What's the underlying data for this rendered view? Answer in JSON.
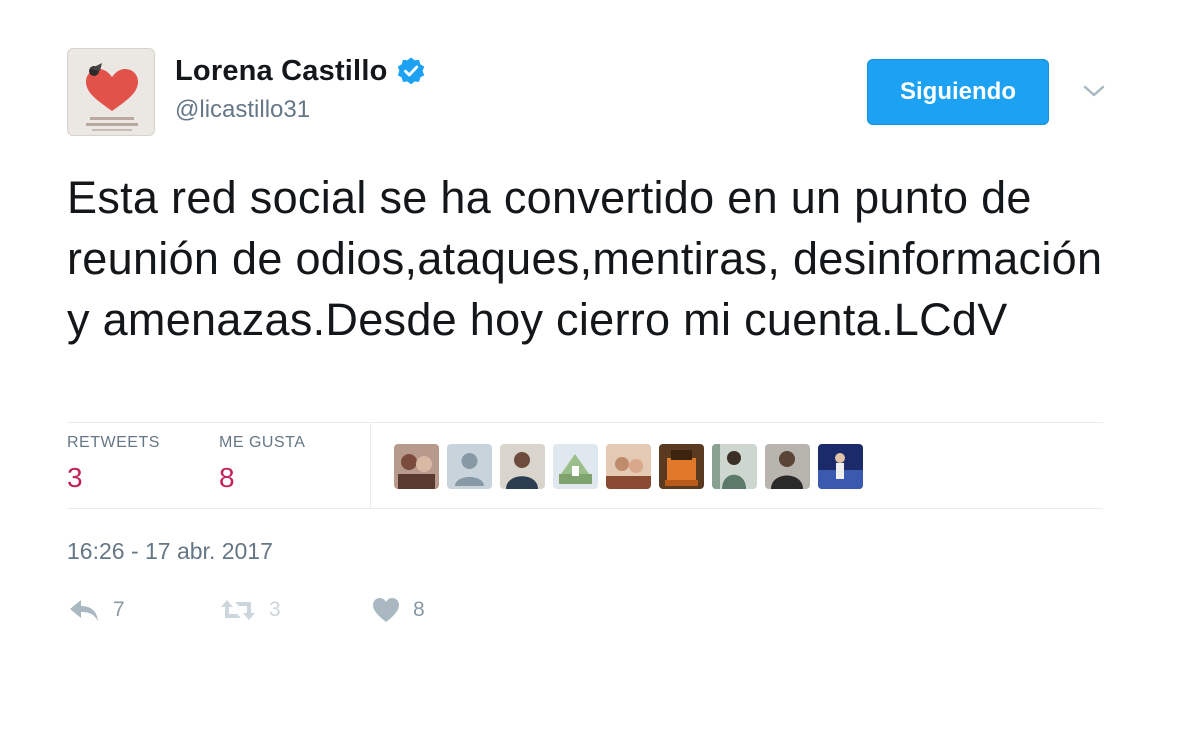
{
  "user": {
    "display_name": "Lorena Castillo",
    "handle": "@licastillo31",
    "verified": true
  },
  "follow_button": {
    "label": "Siguiendo"
  },
  "tweet": {
    "text": "Esta red social se ha convertido en un punto de reunión de odios,ataques,mentiras, desinformación y amenazas.Desde hoy cierro mi cuenta.LCdV",
    "timestamp": "16:26 - 17 abr. 2017"
  },
  "stats": {
    "retweets_label": "RETWEETS",
    "retweets_value": "3",
    "likes_label": "ME GUSTA",
    "likes_value": "8"
  },
  "actions": {
    "reply_count": "7",
    "retweet_count": "3",
    "like_count": "8"
  },
  "colors": {
    "accent": "#1da1f2",
    "stat_value": "#c3235c",
    "secondary_text": "#657786"
  }
}
